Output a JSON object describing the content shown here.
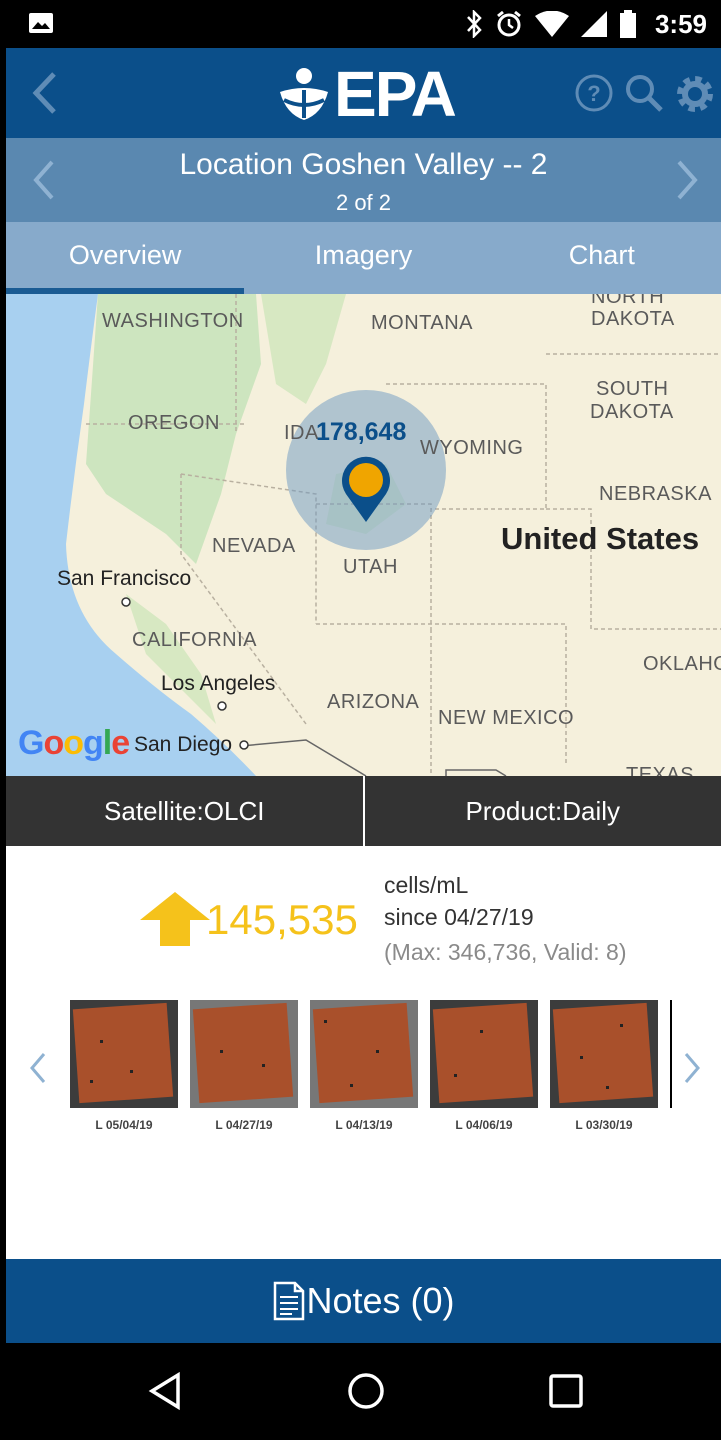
{
  "status_bar": {
    "time": "3:59",
    "icons": [
      "image-icon",
      "bluetooth-icon",
      "alarm-icon",
      "wifi-icon",
      "signal-icon",
      "battery-icon"
    ]
  },
  "app_bar": {
    "logo_text": "EPA",
    "actions": [
      "help-icon",
      "search-icon",
      "settings-icon"
    ]
  },
  "location": {
    "title": "Location Goshen Valley -- 2",
    "position": "2 of 2"
  },
  "tabs": [
    {
      "label": "Overview",
      "active": true
    },
    {
      "label": "Imagery",
      "active": false
    },
    {
      "label": "Chart",
      "active": false
    }
  ],
  "map": {
    "cluster_count": "178,648",
    "labels": {
      "north_dakota_1": "NORTH",
      "north_dakota_2": "DAKOTA",
      "washington": "WASHINGTON",
      "montana": "MONTANA",
      "south_dakota_1": "SOUTH",
      "south_dakota_2": "DAKOTA",
      "oregon": "OREGON",
      "idaho": "IDA",
      "wyoming": "WYOMING",
      "nebraska": "NEBRASKA",
      "nevada": "NEVADA",
      "utah": "UTAH",
      "united_states": "United States",
      "san_francisco": "San Francisco",
      "california": "CALIFORNIA",
      "oklahoma": "OKLAHO",
      "los_angeles": "Los Angeles",
      "arizona": "ARIZONA",
      "new_mexico": "NEW MEXICO",
      "san_diego": "San Diego",
      "texas": "TEXAS"
    },
    "attribution": "Google"
  },
  "info_bar": {
    "satellite_label": "Satellite:",
    "satellite_value": "OLCI",
    "product_label": "Product:",
    "product_value": "Daily"
  },
  "stats": {
    "value": "145,535",
    "unit": "cells/mL",
    "since": "since 04/27/19",
    "max_valid": "(Max: 346,736, Valid: 8)",
    "trend": "up",
    "trend_color": "#f5c21b"
  },
  "thumbnails": [
    {
      "date": "L 05/04/19"
    },
    {
      "date": "L 04/27/19"
    },
    {
      "date": "L 04/13/19"
    },
    {
      "date": "L 04/06/19"
    },
    {
      "date": "L 03/30/19"
    }
  ],
  "notes": {
    "label": "Notes (0)"
  },
  "colors": {
    "primary": "#0b4f8a",
    "secondary": "#5a88b0",
    "tabs": "#87aacb",
    "accent": "#f5c21b",
    "marker": "#f0a500"
  }
}
